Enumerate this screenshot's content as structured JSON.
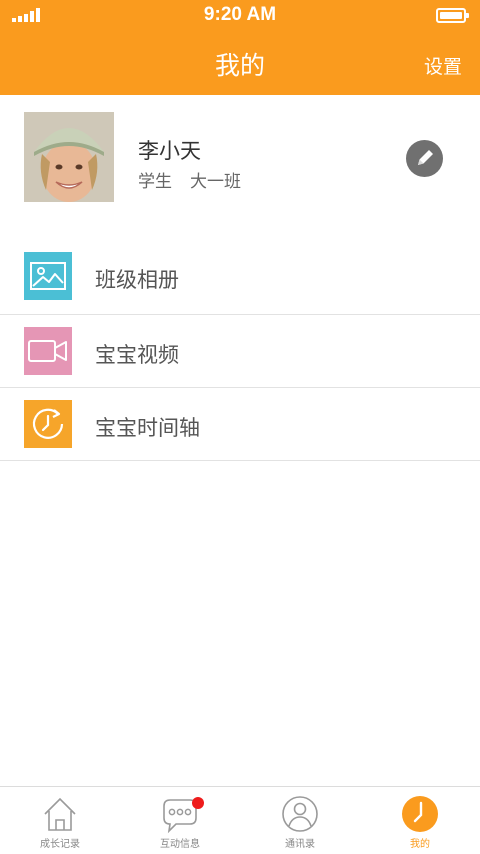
{
  "status_bar": {
    "time": "9:20 AM"
  },
  "header": {
    "title": "我的",
    "settings_label": "设置"
  },
  "profile": {
    "name": "李小天",
    "role": "学生",
    "class": "大一班"
  },
  "menu": {
    "items": [
      {
        "label": "班级相册",
        "icon": "photo-album-icon",
        "color": "#4bbfd5"
      },
      {
        "label": "宝宝视频",
        "icon": "video-camera-icon",
        "color": "#e596b5"
      },
      {
        "label": "宝宝时间轴",
        "icon": "timeline-clock-icon",
        "color": "#f6a52a"
      }
    ]
  },
  "tabbar": {
    "tabs": [
      {
        "label": "成长记录",
        "icon": "house-icon",
        "active": false
      },
      {
        "label": "互动信息",
        "icon": "chat-bubble-icon",
        "active": false,
        "has_badge": true
      },
      {
        "label": "通讯录",
        "icon": "contact-person-icon",
        "active": false
      },
      {
        "label": "我的",
        "icon": "clock-icon",
        "active": true
      }
    ]
  },
  "colors": {
    "accent": "#fa9b1e",
    "badge": "#ee1c1c",
    "divider": "#e2e2e2"
  }
}
